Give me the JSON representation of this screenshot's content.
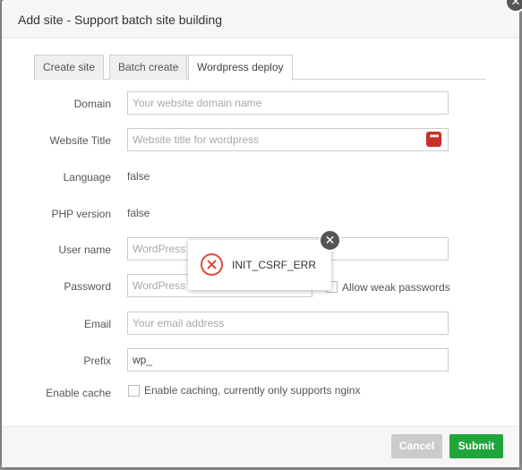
{
  "dialog": {
    "title": "Add site - Support batch site building",
    "close_glyph": "✕"
  },
  "tabs": [
    {
      "label": "Create site",
      "active": false
    },
    {
      "label": "Batch create",
      "active": false
    },
    {
      "label": "Wordpress deploy",
      "active": true
    }
  ],
  "form": {
    "domain": {
      "label": "Domain",
      "placeholder": "Your website domain name",
      "value": ""
    },
    "site_title": {
      "label": "Website Title",
      "placeholder": "Website title for wordpress",
      "value": ""
    },
    "language": {
      "label": "Language",
      "value": "false"
    },
    "php_version": {
      "label": "PHP version",
      "value": "false"
    },
    "user_name": {
      "label": "User name",
      "placeholder": "WordPress b",
      "value": ""
    },
    "password": {
      "label": "Password",
      "placeholder": "WordPress b",
      "value": "",
      "weak_label": "Allow weak passwords",
      "weak_checked": false
    },
    "email": {
      "label": "Email",
      "placeholder": "Your email address",
      "value": ""
    },
    "prefix": {
      "label": "Prefix",
      "value": "wp_"
    },
    "cache": {
      "label": "Enable cache",
      "checkbox_label": "Enable caching, currently only supports nginx",
      "checked": false
    }
  },
  "footer": {
    "cancel_label": "Cancel",
    "submit_label": "Submit"
  },
  "toast": {
    "message": "INIT_CSRF_ERR",
    "close_glyph": "✕"
  },
  "colors": {
    "submit": "#20a53a",
    "cancel_disabled": "#cbcbcb",
    "error": "#e04a3f",
    "title_icon": "#c9302c"
  }
}
